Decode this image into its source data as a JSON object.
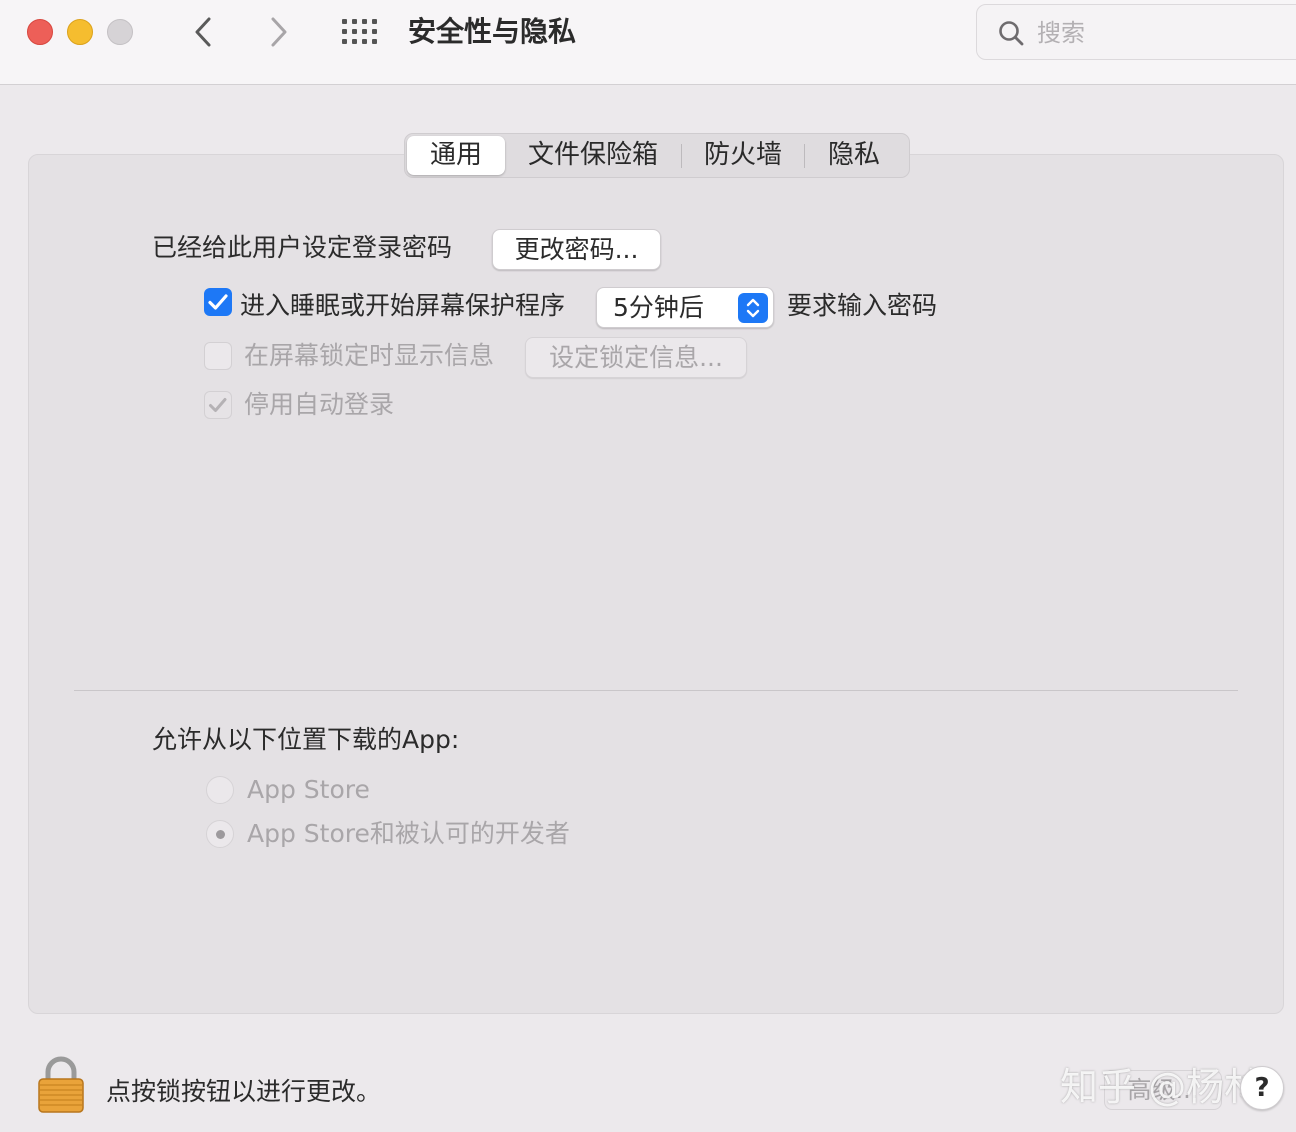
{
  "window": {
    "title": "安全性与隐私",
    "search_placeholder": "搜索"
  },
  "tabs": [
    {
      "label": "通用",
      "active": true
    },
    {
      "label": "文件保险箱",
      "active": false
    },
    {
      "label": "防火墙",
      "active": false
    },
    {
      "label": "隐私",
      "active": false
    }
  ],
  "general": {
    "password_set_label": "已经给此用户设定登录密码",
    "change_password_button": "更改密码...",
    "require_password": {
      "checked": true,
      "label": "进入睡眠或开始屏幕保护程序",
      "delay_value": "5分钟后",
      "suffix": "要求输入密码"
    },
    "show_message": {
      "checked": false,
      "enabled": false,
      "label": "在屏幕锁定时显示信息",
      "button": "设定锁定信息..."
    },
    "disable_auto_login": {
      "checked": true,
      "enabled": false,
      "label": "停用自动登录"
    }
  },
  "downloads": {
    "label": "允许从以下位置下载的App:",
    "options": [
      {
        "label": "App Store",
        "selected": false
      },
      {
        "label": "App Store和被认可的开发者",
        "selected": true
      }
    ]
  },
  "footer": {
    "lock_text": "点按锁按钮以进行更改。",
    "advanced_button": "高级...",
    "help_button": "?"
  },
  "watermark": "知乎 @杨林",
  "colors": {
    "accent": "#1d78f6",
    "close": "#ed5f58",
    "minimize": "#f5bd2f",
    "zoom_disabled": "#d6d3d6"
  }
}
